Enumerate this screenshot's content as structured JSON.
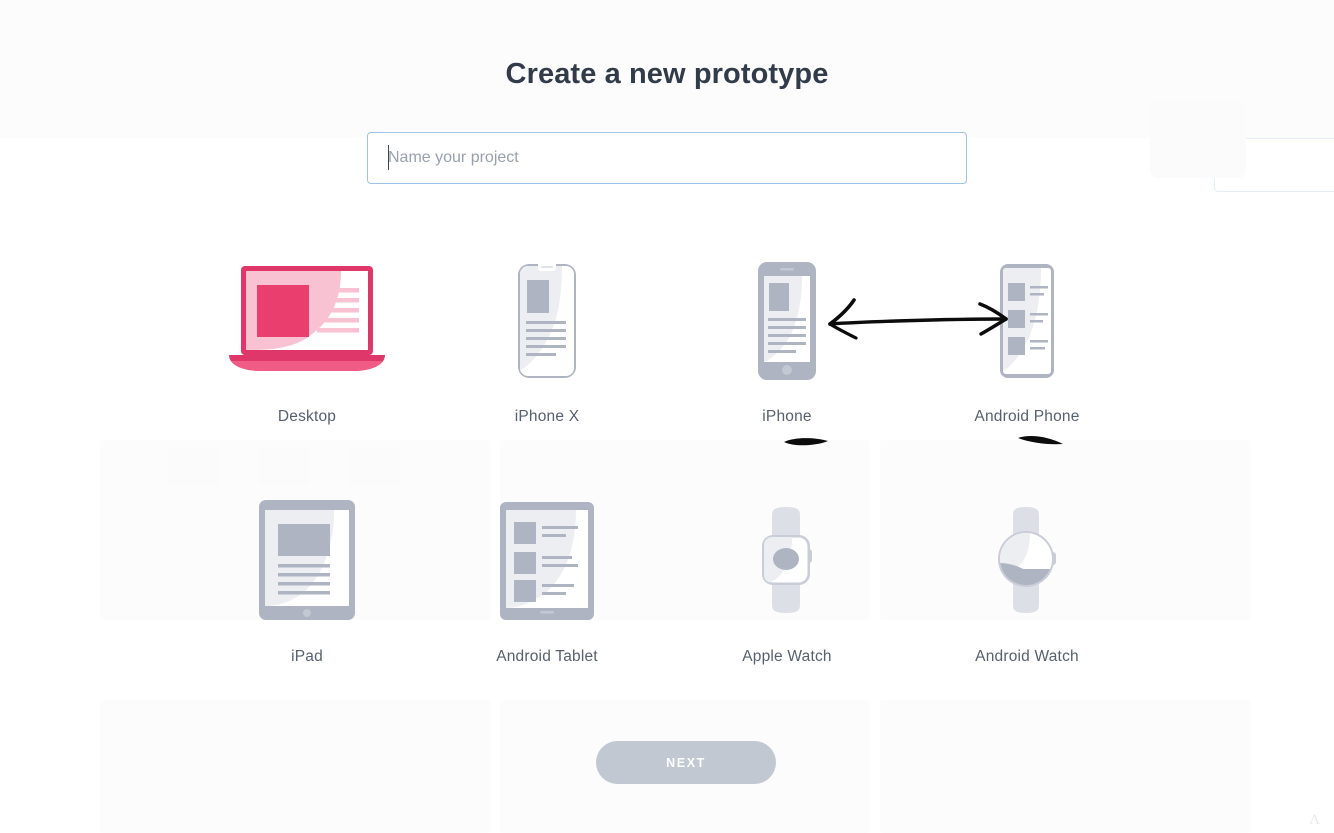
{
  "modal": {
    "title": "Create a new prototype",
    "project_name_placeholder": "Name your project",
    "project_name_value": "",
    "next_label": "NEXT"
  },
  "devices": [
    {
      "id": "desktop",
      "label": "Desktop",
      "icon": "laptop-icon",
      "selected": true,
      "accent": "#e8436f"
    },
    {
      "id": "iphone-x",
      "label": "iPhone X",
      "icon": "iphone-x-icon",
      "selected": false,
      "accent": "#aeb4c2"
    },
    {
      "id": "iphone",
      "label": "iPhone",
      "icon": "iphone-icon",
      "selected": false,
      "accent": "#aeb4c2"
    },
    {
      "id": "android-phone",
      "label": "Android Phone",
      "icon": "android-phone-icon",
      "selected": false,
      "accent": "#aeb4c2"
    },
    {
      "id": "ipad",
      "label": "iPad",
      "icon": "ipad-icon",
      "selected": false,
      "accent": "#aeb4c2"
    },
    {
      "id": "android-tablet",
      "label": "Android Tablet",
      "icon": "android-tablet-icon",
      "selected": false,
      "accent": "#aeb4c2"
    },
    {
      "id": "apple-watch",
      "label": "Apple Watch",
      "icon": "apple-watch-icon",
      "selected": false,
      "accent": "#aeb4c2"
    },
    {
      "id": "android-watch",
      "label": "Android Watch",
      "icon": "android-watch-icon",
      "selected": false,
      "accent": "#aeb4c2"
    }
  ],
  "annotations": [
    {
      "id": "double-arrow",
      "type": "hand-drawn-double-arrow",
      "from": "iPhone",
      "to": "Android Phone"
    },
    {
      "id": "mark-iphone",
      "type": "hand-drawn-underline",
      "under": "iPhone"
    },
    {
      "id": "mark-android",
      "type": "hand-drawn-underline",
      "under": "Android Phone"
    }
  ],
  "colors": {
    "accent_selected": "#e8436f",
    "accent_selected_light": "#f9c2d2",
    "device_grey": "#aeb4c2",
    "device_grey_light": "#eceef2",
    "title": "#313b49",
    "label": "#57606e",
    "input_border_focus": "#9ec5e8",
    "next_button_bg": "#c2c8d2",
    "background": "#ffffff"
  }
}
